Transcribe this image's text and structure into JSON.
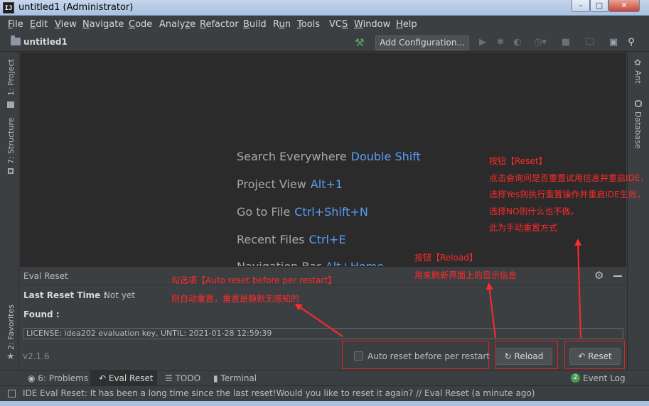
{
  "window": {
    "title": "untitled1 (Administrator)",
    "app_icon_text": "IJ",
    "controls": [
      "minimize",
      "maximize",
      "close"
    ]
  },
  "menu": [
    {
      "pre": "",
      "u": "F",
      "post": "ile"
    },
    {
      "pre": "",
      "u": "E",
      "post": "dit"
    },
    {
      "pre": "",
      "u": "V",
      "post": "iew"
    },
    {
      "pre": "",
      "u": "N",
      "post": "avigate"
    },
    {
      "pre": "",
      "u": "C",
      "post": "ode"
    },
    {
      "pre": "Analy",
      "u": "z",
      "post": "e"
    },
    {
      "pre": "",
      "u": "R",
      "post": "efactor"
    },
    {
      "pre": "",
      "u": "B",
      "post": "uild"
    },
    {
      "pre": "R",
      "u": "u",
      "post": "n"
    },
    {
      "pre": "",
      "u": "T",
      "post": "ools"
    },
    {
      "pre": "VC",
      "u": "S",
      "post": ""
    },
    {
      "pre": "",
      "u": "W",
      "post": "indow"
    },
    {
      "pre": "",
      "u": "H",
      "post": "elp"
    }
  ],
  "navbar": {
    "project_name": "untitled1",
    "add_configuration": "Add Configuration..."
  },
  "left_strip": {
    "project_tab": "1: Project",
    "structure_tab": "7: Structure",
    "favorites_tab": "2: Favorites"
  },
  "right_strip": {
    "ant_tab": "Ant",
    "database_tab": "Database"
  },
  "welcome_tips": [
    {
      "label": "Search Everywhere",
      "key": "Double Shift"
    },
    {
      "label": "Project View",
      "key": "Alt+1"
    },
    {
      "label": "Go to File",
      "key": "Ctrl+Shift+N"
    },
    {
      "label": "Recent Files",
      "key": "Ctrl+E"
    },
    {
      "label": "Navigation Bar",
      "key": "Alt+Home"
    }
  ],
  "eval_reset": {
    "title": "Eval Reset",
    "last_reset_label": "Last Reset Time :",
    "last_reset_value": "Not yet",
    "found_label": "Found :",
    "license_line": "LICENSE: idea202 evaluation key, UNTIL: 2021-01-28 12:59:39",
    "version": "v2.1.6",
    "auto_reset_label": "Auto reset before per restart",
    "auto_reset_checked": false,
    "reload_label": "Reload",
    "reset_label": "Reset"
  },
  "tool_tabs": {
    "problems": "6: Problems",
    "eval_reset": "Eval Reset",
    "todo": "TODO",
    "terminal": "Terminal",
    "event_log_count": "2",
    "event_log": "Event Log"
  },
  "status": {
    "message": "IDE Eval Reset: It has been a long time since the last reset!Would you like to reset it again? // Eval Reset (a minute ago)"
  },
  "annotations": {
    "reset": [
      "按钮【Reset】",
      "点击会询问是否重置试用信息并重启IDE，",
      "选择Yes则执行重置操作并重启IDE生效，",
      "选择NO则什么也不做。",
      "此为手动重置方式"
    ],
    "reload": [
      "按钮【Reload】",
      "用来刷新界面上的显示信息"
    ],
    "auto": [
      "勾选项【Auto reset before per restart】",
      "则自动重置，重置是静默无感知的"
    ]
  },
  "colors": {
    "background": "#3c3f41",
    "editor": "#2b2b2b",
    "shortcut": "#589df6",
    "annotation": "#ff2a2a"
  }
}
